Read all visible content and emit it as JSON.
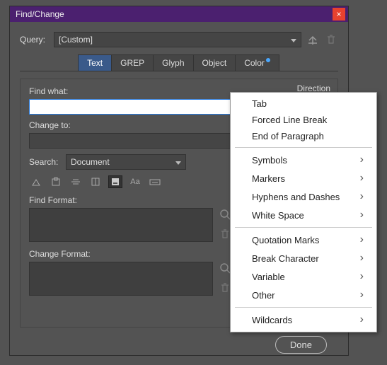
{
  "window": {
    "title": "Find/Change"
  },
  "query": {
    "label": "Query:",
    "value": "[Custom]"
  },
  "tabs": [
    {
      "label": "Text",
      "active": true
    },
    {
      "label": "GREP"
    },
    {
      "label": "Glyph"
    },
    {
      "label": "Object"
    },
    {
      "label": "Color",
      "dot": true
    }
  ],
  "find": {
    "label": "Find what:",
    "value": ""
  },
  "change": {
    "label": "Change to:",
    "value": ""
  },
  "direction": {
    "label": "Direction"
  },
  "search": {
    "label": "Search:",
    "value": "Document"
  },
  "findformat": {
    "label": "Find Format:"
  },
  "changeformat": {
    "label": "Change Format:"
  },
  "done": {
    "label": "Done"
  },
  "flyout": {
    "group1": [
      {
        "label": "Tab"
      },
      {
        "label": "Forced Line Break"
      },
      {
        "label": "End of Paragraph"
      }
    ],
    "group2": [
      {
        "label": "Symbols",
        "sub": true
      },
      {
        "label": "Markers",
        "sub": true
      },
      {
        "label": "Hyphens and Dashes",
        "sub": true
      },
      {
        "label": "White Space",
        "sub": true
      }
    ],
    "group3": [
      {
        "label": "Quotation Marks",
        "sub": true
      },
      {
        "label": "Break Character",
        "sub": true
      },
      {
        "label": "Variable",
        "sub": true
      },
      {
        "label": "Other",
        "sub": true
      }
    ],
    "group4": [
      {
        "label": "Wildcards",
        "sub": true
      }
    ]
  }
}
